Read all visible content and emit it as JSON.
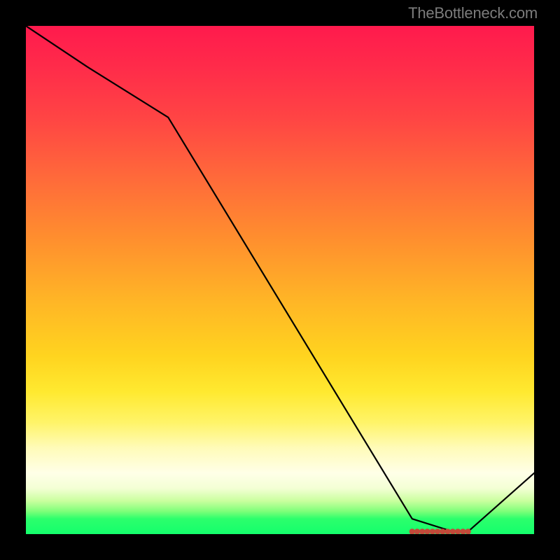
{
  "watermark": "TheBottleneck.com",
  "chart_data": {
    "type": "line",
    "x": [
      0,
      12,
      28,
      76,
      84,
      87,
      100
    ],
    "values": [
      100,
      92,
      82,
      3,
      0.5,
      0.5,
      12
    ],
    "xlim": [
      0,
      100
    ],
    "ylim": [
      0,
      100
    ],
    "title": "",
    "xlabel": "",
    "ylabel": "",
    "grid": false,
    "markers": {
      "x_range": [
        76,
        87
      ],
      "y": 0.5,
      "count": 12,
      "color": "#c24a3a"
    },
    "line_color": "#000000",
    "background": "heatmap-gradient-red-to-green"
  }
}
